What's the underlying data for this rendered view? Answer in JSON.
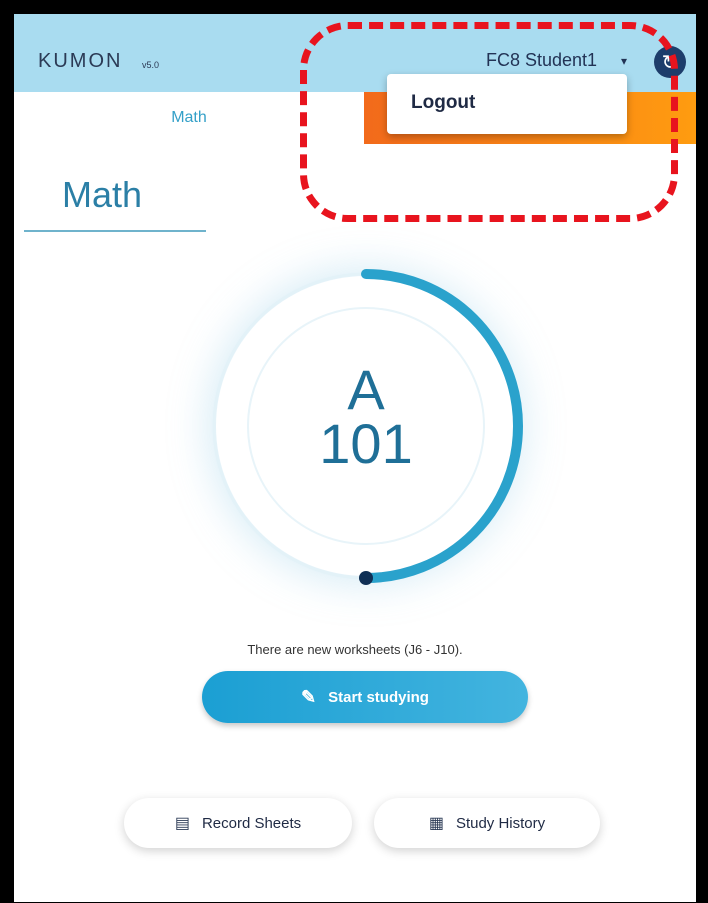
{
  "header": {
    "logo": "KUMON",
    "logo_sub": "v5.0",
    "user_name": "FC8 Student1",
    "user_caret": "▾",
    "sync_icon": "↻"
  },
  "tabs": {
    "math_label": "Math"
  },
  "dropdown": {
    "logout_label": "Logout"
  },
  "section": {
    "title": "Math"
  },
  "progress": {
    "level": "A",
    "worksheet": "101",
    "fraction": 0.5
  },
  "message": "There are new worksheets (J6 - J10).",
  "buttons": {
    "start_studying": "Start studying",
    "record_sheets": "Record Sheets",
    "study_history": "Study History"
  },
  "colors": {
    "header_bg": "#a9dcf0",
    "accent": "#1b9fd3",
    "tab_orange": "#f26a1b",
    "highlight": "#e8141e"
  }
}
